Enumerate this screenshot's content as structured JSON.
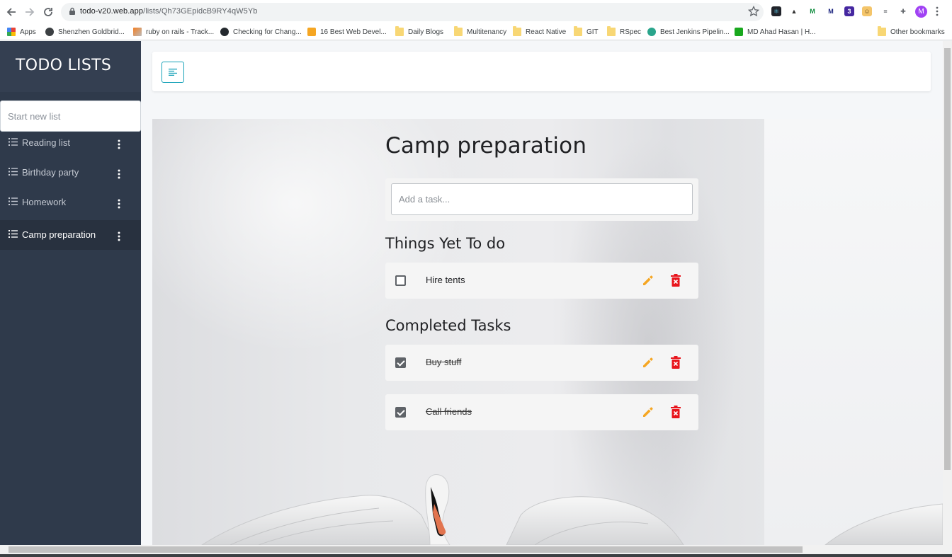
{
  "browser": {
    "url_host": "todo-v20.web.app",
    "url_path": "/lists/Qh73GEpidcB9RY4qW5Yb",
    "profile_initial": "M",
    "extension_badge": "3",
    "bookmarks": [
      {
        "label": "Apps",
        "icon": "apps-grid-icon"
      },
      {
        "label": "Shenzhen Goldbrid...",
        "icon": "globe-icon"
      },
      {
        "label": "ruby on rails - Track...",
        "icon": "stackoverflow-icon"
      },
      {
        "label": "Checking for Chang...",
        "icon": "github-icon"
      },
      {
        "label": "16 Best Web Devel...",
        "icon": "s-logo-icon"
      },
      {
        "label": "Daily Blogs",
        "icon": "folder-icon"
      },
      {
        "label": "Multitenancy",
        "icon": "folder-icon"
      },
      {
        "label": "React Native",
        "icon": "folder-icon"
      },
      {
        "label": "GIT",
        "icon": "folder-icon"
      },
      {
        "label": "RSpec",
        "icon": "folder-icon"
      },
      {
        "label": "Best Jenkins Pipelin...",
        "icon": "jenkins-icon"
      },
      {
        "label": "MD Ahad Hasan | H...",
        "icon": "power-icon"
      },
      {
        "label": "Other bookmarks",
        "icon": "folder-icon"
      }
    ]
  },
  "sidebar": {
    "brand": "TODO LISTS",
    "new_list_placeholder": "Start new list",
    "items": [
      {
        "label": "Reading list",
        "active": false
      },
      {
        "label": "Birthday party",
        "active": false
      },
      {
        "label": "Homework",
        "active": false
      },
      {
        "label": "Camp preparation",
        "active": true
      }
    ]
  },
  "main": {
    "list_title": "Camp preparation",
    "add_task_placeholder": "Add a task...",
    "todo_heading": "Things Yet To do",
    "completed_heading": "Completed Tasks",
    "todo_tasks": [
      {
        "text": "Hire tents",
        "done": false
      }
    ],
    "completed_tasks": [
      {
        "text": "Buy stuff",
        "done": true
      },
      {
        "text": "Call friends",
        "done": true
      }
    ]
  },
  "colors": {
    "sidebar_bg": "#343f51",
    "sidebar_active": "#28313f",
    "edit_icon": "#f5a623",
    "delete_icon": "#e8141b",
    "toggle_border": "#17a2b8"
  }
}
